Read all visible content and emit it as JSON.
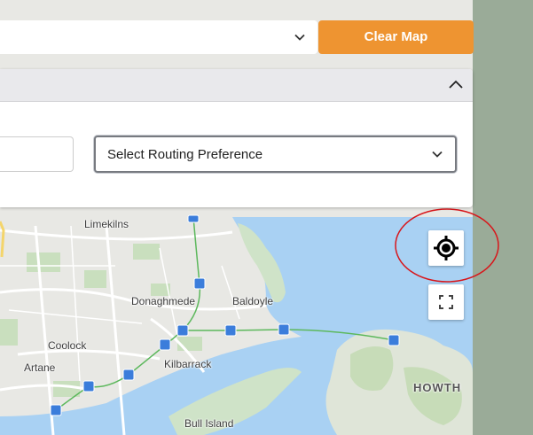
{
  "top_select": {
    "value": ""
  },
  "clear_button": {
    "label": "Clear Map",
    "color": "#ee9431"
  },
  "route_panel": {
    "routing_select": {
      "value": "Select Routing Preference"
    },
    "origin_input": {
      "value": ""
    }
  },
  "map": {
    "places": {
      "limekilns": "Limekilns",
      "donaghmede": "Donaghmede",
      "baldoyle": "Baldoyle",
      "coolock": "Coolock",
      "artane": "Artane",
      "kilbarrack": "Kilbarrack",
      "bull_island": "Bull Island",
      "howth": "HOWTH"
    },
    "controls": {
      "locate": "my-location-icon",
      "fullscreen": "fullscreen-icon"
    },
    "annotation_color": "#d8161b"
  }
}
